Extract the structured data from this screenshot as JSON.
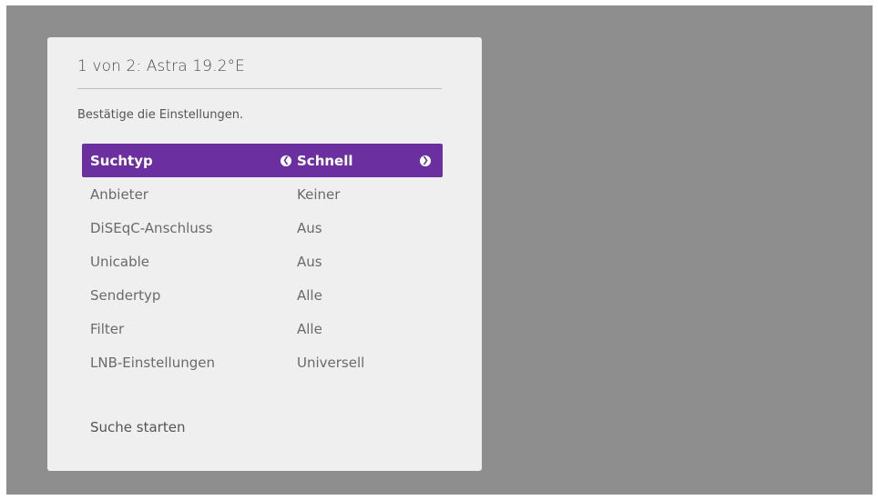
{
  "dialog": {
    "title": "1 von 2: Astra 19.2°E",
    "subtitle": "Bestätige die Einstellungen."
  },
  "settings": [
    {
      "label": "Suchtyp",
      "value": "Schnell",
      "selected": true
    },
    {
      "label": "Anbieter",
      "value": "Keiner"
    },
    {
      "label": "DiSEqC-Anschluss",
      "value": "Aus"
    },
    {
      "label": "Unicable",
      "value": "Aus"
    },
    {
      "label": "Sendertyp",
      "value": "Alle"
    },
    {
      "label": "Filter",
      "value": "Alle"
    },
    {
      "label": "LNB-Einstellungen",
      "value": "Universell"
    }
  ],
  "actions": {
    "start_search": "Suche starten"
  },
  "icons": {
    "arrow_left": "chevron-left-icon",
    "arrow_right": "chevron-right-icon"
  },
  "colors": {
    "accent": "#6c2fa0",
    "screen_bg": "#8e8e8e",
    "panel_bg": "#efefef"
  }
}
